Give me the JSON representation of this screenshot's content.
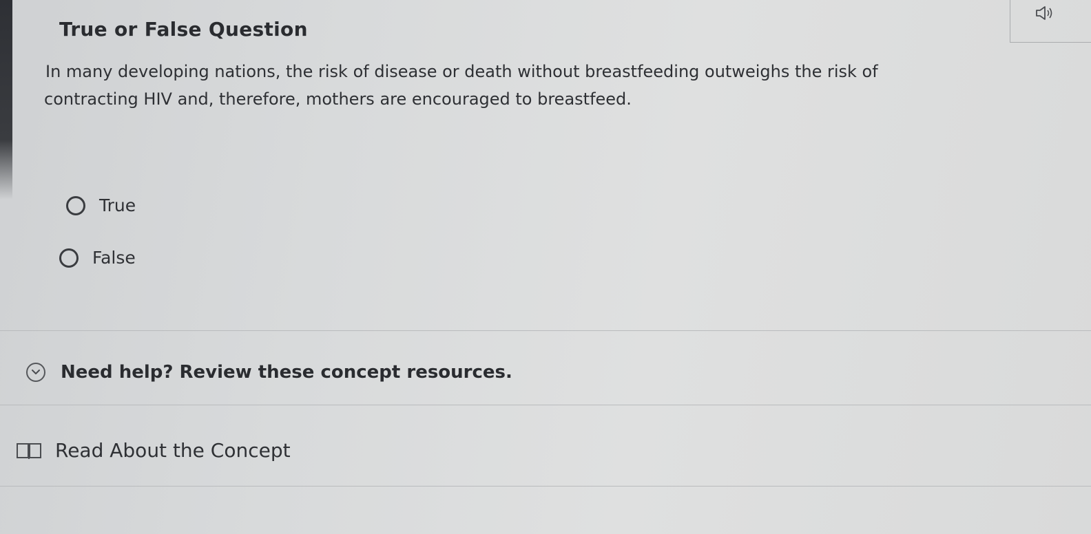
{
  "question": {
    "title": "True or False Question",
    "text_line1": "In many developing nations, the risk of disease or death without breastfeeding outweighs the risk of",
    "text_line2": "contracting HIV and, therefore, mothers are encouraged to breastfeed."
  },
  "options": [
    {
      "label": "True",
      "selected": false
    },
    {
      "label": "False",
      "selected": false
    }
  ],
  "help": {
    "label": "Need help? Review these concept resources.",
    "icon": "chevron-down-circle-icon"
  },
  "resources": [
    {
      "label": "Read About the Concept",
      "icon": "book-icon"
    }
  ],
  "audio": {
    "icon": "speaker-icon"
  }
}
